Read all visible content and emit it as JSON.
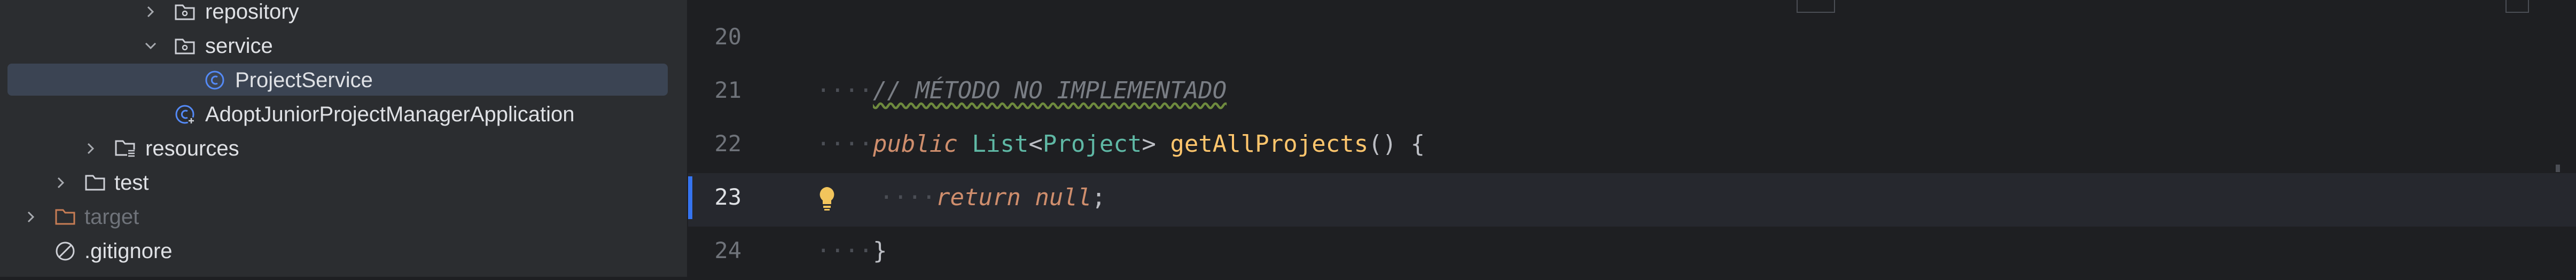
{
  "project_tree": {
    "items": [
      {
        "label": "repository",
        "kind": "package",
        "expanded": false
      },
      {
        "label": "service",
        "kind": "package",
        "expanded": true
      },
      {
        "label": "ProjectService",
        "kind": "class",
        "selected": true
      },
      {
        "label": "AdoptJuniorProjectManagerApplication",
        "kind": "spring-app-class"
      },
      {
        "label": "resources",
        "kind": "folder",
        "expanded": false
      },
      {
        "label": "test",
        "kind": "folder",
        "expanded": false
      },
      {
        "label": "target",
        "kind": "excluded-folder",
        "expanded": false
      },
      {
        "label": ".gitignore",
        "kind": "ignored-file"
      }
    ]
  },
  "editor": {
    "lines": [
      {
        "number": "20"
      },
      {
        "number": "21",
        "comment": "// MÉTODO NO IMPLEMENTADO"
      },
      {
        "number": "22",
        "kw": "public",
        "type": "List",
        "lt": "<",
        "typename": "Project",
        "gt": ">",
        "fn": "getAllProjects",
        "rest": "() {"
      },
      {
        "number": "23",
        "kw": "return",
        "value": "null",
        "semi": ";"
      },
      {
        "number": "24",
        "brace": "}"
      }
    ]
  },
  "colors": {
    "sidebar_bg": "#2b2d30",
    "editor_bg": "#1e1f22",
    "selection": "#3b4453",
    "keyword": "#cf8e6d",
    "type_param": "#5fb8a5",
    "method": "#56a8f5",
    "comment": "#7a7e85"
  }
}
